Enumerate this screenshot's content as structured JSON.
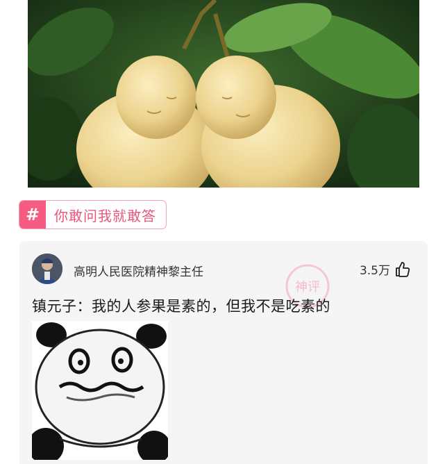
{
  "post": {
    "image": {
      "icon": "buddha-shaped-pears-photo"
    }
  },
  "topic_tag": {
    "hash_symbol": "#",
    "label": "你敢问我就敢答",
    "accent_color": "#f45c82"
  },
  "comment": {
    "author": "高明人民医院精神黎主任",
    "likes": "3.5万",
    "text": "镇元子：我的人参果是素的，但我不是吃素的",
    "watermark_text": "神评",
    "meme": {
      "icon": "panda-face-meme"
    }
  }
}
